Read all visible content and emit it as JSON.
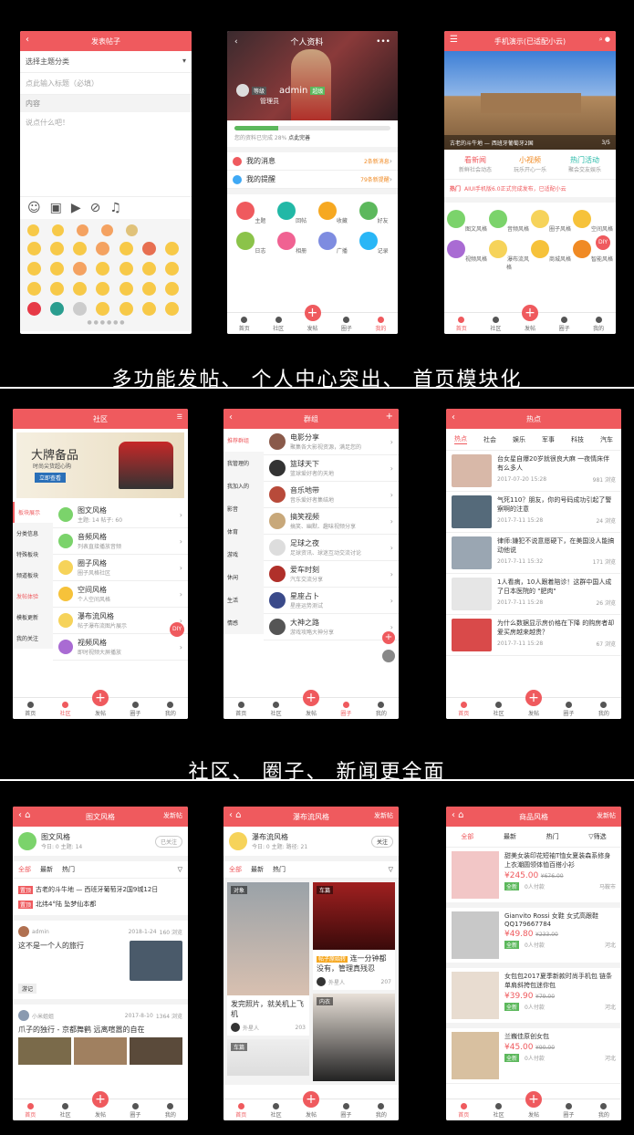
{
  "colors": {
    "accent": "#ef5a5e",
    "bg": "#000000"
  },
  "captions": [
    "多功能发帖、 个人中心突出、 首页模块化",
    "社区、 圈子、 新闻更全面"
  ],
  "tabbar": {
    "home": "首页",
    "community": "社区",
    "post": "发帖",
    "circle": "圈子",
    "mine": "我的",
    "plus": "+"
  },
  "post": {
    "title": "发表帖子",
    "category": "选择主题分类",
    "title_ph": "点此输入标题（必填）",
    "content_label": "内容",
    "content_ph": "说点什么吧！"
  },
  "profile": {
    "title": "个人资料",
    "username": "admin",
    "level": "超级",
    "role_badge": "等级",
    "role": "管理员",
    "progress_text": "您的资料已完成 28%",
    "progress_link": "点此完善",
    "rows": [
      {
        "label": "我的消息",
        "value": "2条新消息"
      },
      {
        "label": "我的提醒",
        "value": "79条新提醒"
      }
    ],
    "grid": [
      "主题",
      "回帖",
      "收藏",
      "好友",
      "日志",
      "相册",
      "广播",
      "记录"
    ]
  },
  "home": {
    "title": "手机演示(已适配小云)",
    "banner_caption": "古老的斗牛地 — 西班牙葡萄牙2国",
    "banner_page": "3/5",
    "tiles": [
      {
        "title": "看新闻",
        "sub": "新鲜社会动态"
      },
      {
        "title": "小视频",
        "sub": "玩乐开心一乐"
      },
      {
        "title": "热门活动",
        "sub": "聚会交友娱乐"
      }
    ],
    "notice_tag": "热门",
    "notice": "AIUI手机版6.0正式完成发布，已适配小云",
    "grid": [
      "图文风格",
      "音频风格",
      "圈子风格",
      "空间风格",
      "视频风格",
      "瀑布流风格",
      "商城风格",
      "智能风格"
    ],
    "diy": "DIY"
  },
  "community": {
    "title": "社区",
    "banner_title": "大牌备品",
    "banner_sub": "时尚尖货超心购",
    "banner_btn": "立即查看",
    "side": [
      "板块展示",
      "分类信息",
      "特殊板块",
      "频道板块",
      "发帖体验",
      "模板更新",
      "我的关注"
    ],
    "items": [
      {
        "title": "图文风格",
        "sub": "主题: 14 帖子: 60"
      },
      {
        "title": "音频风格",
        "sub": "列表直接播放音频"
      },
      {
        "title": "圈子风格",
        "sub": "圈子风格社区"
      },
      {
        "title": "空间风格",
        "sub": "个人空间风格"
      },
      {
        "title": "瀑布流风格",
        "sub": "帖子瀑布流图片展示"
      },
      {
        "title": "视频风格",
        "sub": "即时视频大屏播放"
      }
    ],
    "diy": "DIY"
  },
  "circle": {
    "title": "群组",
    "side": [
      "推荐群组",
      "我管理的",
      "我加入的",
      "影音",
      "体育",
      "游戏",
      "休闲",
      "生活",
      "情感"
    ],
    "items": [
      {
        "title": "电影分享",
        "sub": "聚集各大影视资源，满足您的"
      },
      {
        "title": "篮球天下",
        "sub": "篮球爱好者的天地"
      },
      {
        "title": "音乐地带",
        "sub": "音乐爱好者集结地"
      },
      {
        "title": "搞笑视频",
        "sub": "搞笑、幽默、趣味视频分享"
      },
      {
        "title": "足球之夜",
        "sub": "足球资讯、球迷互动交流讨论"
      },
      {
        "title": "爱车时刻",
        "sub": "汽车交流分享"
      },
      {
        "title": "星座占卜",
        "sub": "星座运势测试"
      },
      {
        "title": "大神之路",
        "sub": "游戏攻略大神分享"
      }
    ]
  },
  "news": {
    "title": "热点",
    "tabs": [
      "热点",
      "社会",
      "娱乐",
      "军事",
      "科技",
      "汽车"
    ],
    "items": [
      {
        "title": "台女星自爆20岁就很良大麻 一夜情床伴有么多人",
        "date": "2017-07-20 15:28",
        "views": "981 浏览"
      },
      {
        "title": "气死110？朋友，你的号码成功引起了警察啊的注意",
        "date": "2017-7-11 15:28",
        "views": "24 浏览"
      },
      {
        "title": "律师:嫌犯不说意愿硬下，在美国没人能搞动他说",
        "date": "2017-7-11 15:32",
        "views": "171 浏览"
      },
      {
        "title": "1人看病，10人跟着陪诊！这群中国人成了日本医院的 \"肥肉\"",
        "date": "2017-7-11 15:28",
        "views": "26 浏览"
      },
      {
        "title": "为什么数据显示房价格在下降 的购房者却爱买房越来越贵？",
        "date": "2017-7-11 15:28",
        "views": "67 浏览"
      }
    ]
  },
  "tuwen": {
    "title": "图文风格",
    "post_btn": "发新帖",
    "forum": "图文风格",
    "forum_stats": "今日: 0 主题: 14",
    "follow": "已关注",
    "tabs": [
      "全部",
      "最新",
      "热门"
    ],
    "tops": [
      {
        "tag": "置顶",
        "text": "古老的斗牛地 — 西班牙葡萄牙2国9城12日"
      },
      {
        "tag": "置顶",
        "text": "北纬4°陆 坠梦仙本都"
      }
    ],
    "post1": {
      "user": "admin",
      "date": "2018-1-24",
      "views": "160 浏览",
      "title": "这不是一个人的旅行",
      "tag": "游记"
    },
    "post2": {
      "user": "小米姐姐",
      "date": "2017-8-10",
      "views": "1364 浏览",
      "title": "爪子的独行 - 京都舞鹤 远离喧嚣的自在"
    }
  },
  "waterfall": {
    "title": "瀑布流风格",
    "post_btn": "发新帖",
    "forum": "瀑布流风格",
    "forum_stats": "今日: 0 主题: 路径: 21",
    "follow": "关注",
    "tabs": [
      "全部",
      "最新",
      "热门"
    ],
    "cards": [
      {
        "tag": "对象",
        "title": "发完照片，就关机上飞机",
        "user": "外星人",
        "likes": "203"
      },
      {
        "tag": "车篇",
        "title": "连一分钟都没有，管理真残忍",
        "badge": "帖子原始转",
        "user": "外星人",
        "likes": "207"
      },
      {
        "tag": "车篇"
      },
      {
        "tag": "内衣"
      }
    ]
  },
  "shop": {
    "title": "商品风格",
    "post_btn": "发新帖",
    "tabs": [
      "全部",
      "最新",
      "热门",
      "筛选"
    ],
    "items": [
      {
        "title": "甜美女装印花短袖T恤女夏装森系修身上衣潮圆领体恤百搭小衫",
        "price": "¥245.00",
        "old": "¥676.00",
        "tag": "全新",
        "buyers": "0人付款",
        "place": "马鞍市"
      },
      {
        "title": "Gianvito Rossi 女鞋 女式高跟鞋QQ179667784",
        "price": "¥49.80",
        "old": "¥233.00",
        "tag": "全新",
        "buyers": "0人付款",
        "place": "河北"
      },
      {
        "title": "女包包2017夏季新款时尚手机包 链条单肩斜挎包迷你包",
        "price": "¥39.90",
        "old": "¥79.00",
        "tag": "全新",
        "buyers": "0人付款",
        "place": "河北"
      },
      {
        "title": "兰巍佳原创女包",
        "price": "¥45.00",
        "old": "¥90.00",
        "tag": "全新",
        "buyers": "0人付款",
        "place": "河北"
      }
    ]
  }
}
